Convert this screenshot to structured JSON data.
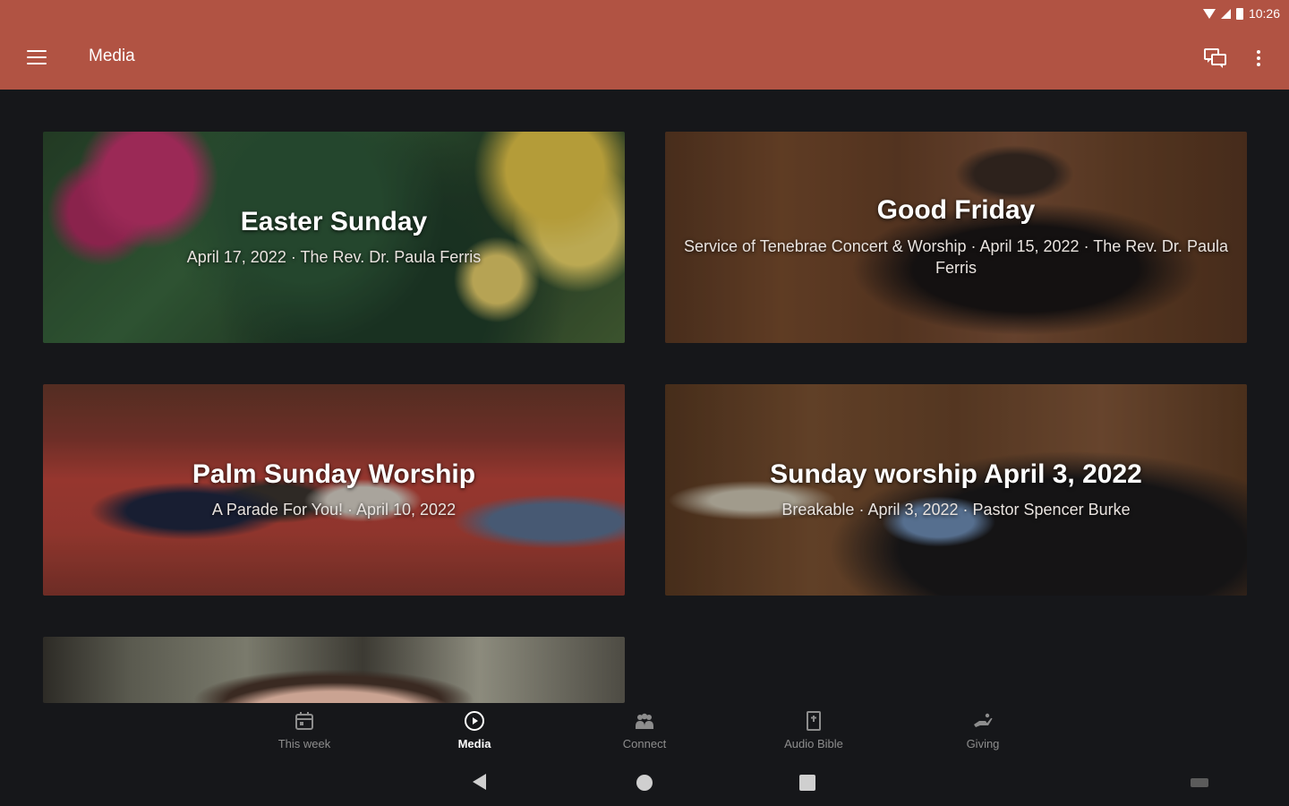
{
  "status_bar": {
    "time": "10:26"
  },
  "app_bar": {
    "title": "Media"
  },
  "media": [
    {
      "title": "Easter Sunday",
      "subtitle": "April 17, 2022 · The Rev. Dr. Paula Ferris"
    },
    {
      "title": "Good Friday",
      "subtitle": "Service of Tenebrae Concert & Worship · April 15, 2022 · The Rev. Dr. Paula Ferris"
    },
    {
      "title": "Palm Sunday Worship",
      "subtitle": "A Parade For You! · April 10, 2022"
    },
    {
      "title": "Sunday worship April 3, 2022",
      "subtitle": "Breakable · April 3, 2022 · Pastor Spencer Burke"
    }
  ],
  "bottom_nav": [
    {
      "label": "This week",
      "icon": "calendar-icon"
    },
    {
      "label": "Media",
      "icon": "play-circle-icon",
      "active": true
    },
    {
      "label": "Connect",
      "icon": "people-icon"
    },
    {
      "label": "Audio Bible",
      "icon": "bible-icon"
    },
    {
      "label": "Giving",
      "icon": "giving-hand-icon"
    }
  ],
  "colors": {
    "app_bar": "#b15343",
    "background": "#16171a"
  }
}
